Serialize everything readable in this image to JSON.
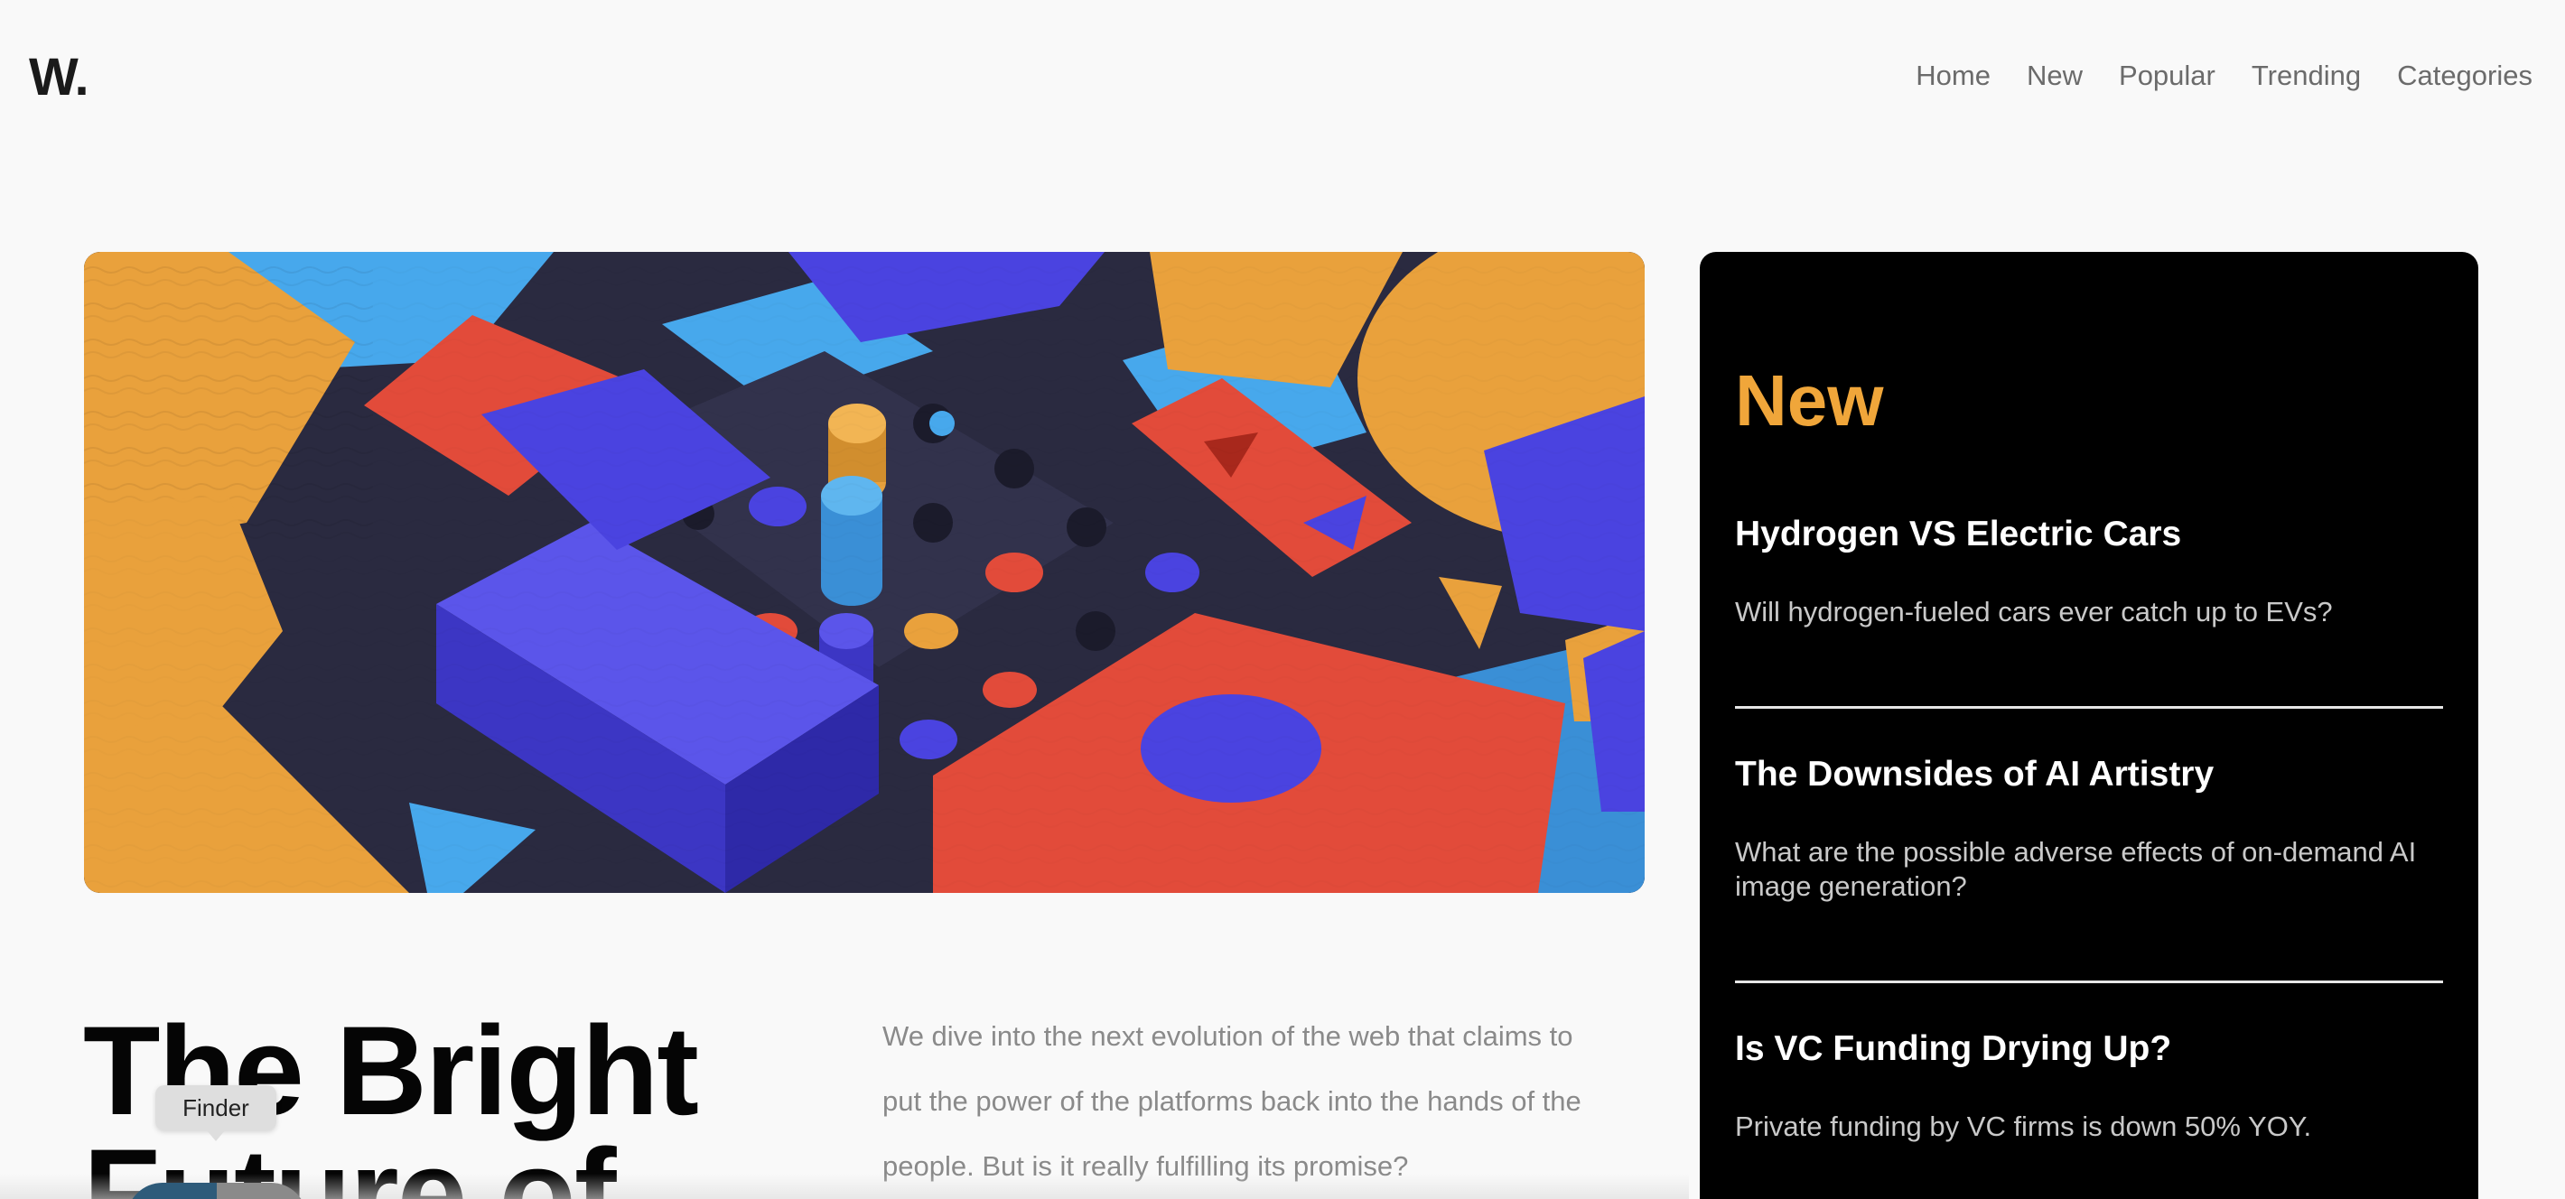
{
  "header": {
    "logo": "W.",
    "nav": [
      "Home",
      "New",
      "Popular",
      "Trending",
      "Categories"
    ]
  },
  "hero": {
    "image": "abstract-3d-blocks-illustration",
    "title": "The Bright Future of",
    "intro": "We dive into the next evolution of the web that claims to put the power of the platforms back into the hands of the people. But is it really fulfilling its promise?"
  },
  "sidebar": {
    "title": "New",
    "items": [
      {
        "title": "Hydrogen VS Electric Cars",
        "summary": "Will hydrogen-fueled cars ever catch up to EVs?"
      },
      {
        "title": "The Downsides of AI Artistry",
        "summary": "What are the possible adverse effects of on-demand AI image generation?"
      },
      {
        "title": "Is VC Funding Drying Up?",
        "summary": "Private funding by VC firms is down 50% YOY."
      }
    ]
  },
  "dock": {
    "tooltip": "Finder"
  },
  "colors": {
    "accent": "#f0a63a",
    "background": "#f9f9f9",
    "sidebar_bg": "#000000",
    "orange_block": "#e9a13c",
    "blue_block": "#4a43e0",
    "sky_block": "#47a8ec",
    "red_block": "#e24b3a",
    "dark_base": "#2a2a40"
  }
}
